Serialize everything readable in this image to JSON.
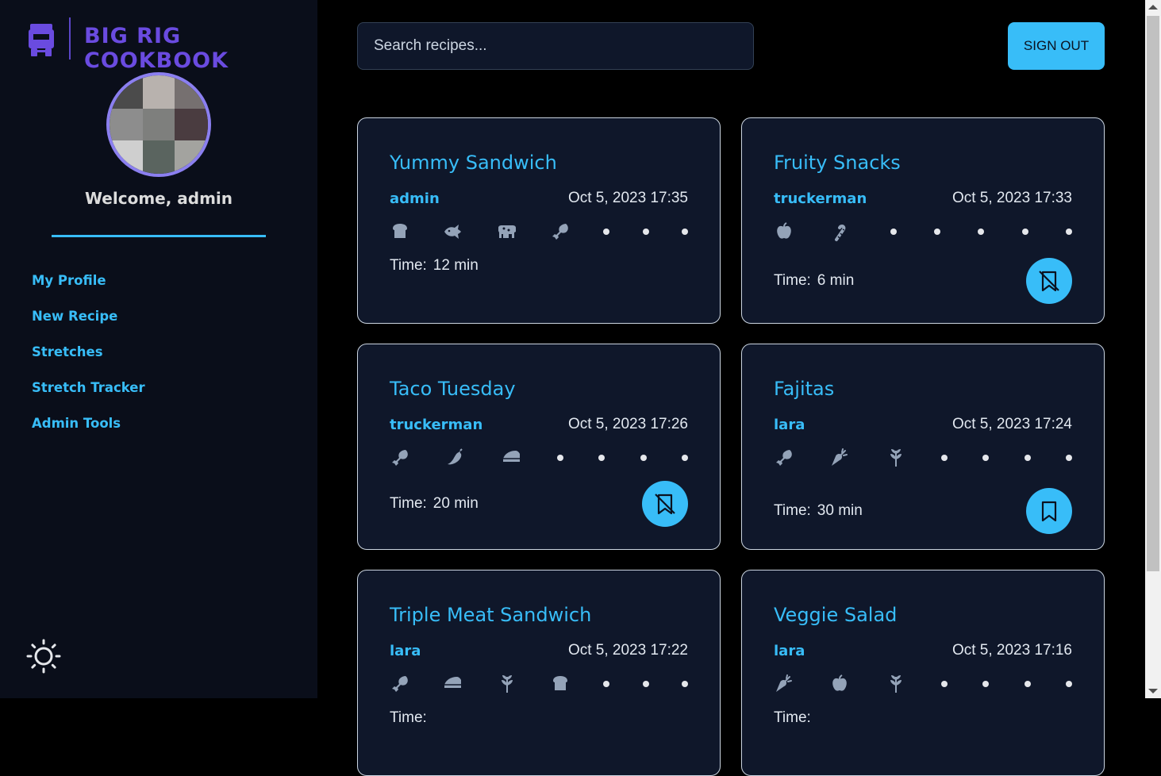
{
  "app": {
    "title": "BIG RIG COOKBOOK",
    "welcome": "Welcome, admin"
  },
  "sidebar": {
    "items": [
      {
        "label": "My Profile"
      },
      {
        "label": "New Recipe"
      },
      {
        "label": "Stretches"
      },
      {
        "label": "Stretch Tracker"
      },
      {
        "label": "Admin Tools"
      }
    ]
  },
  "header": {
    "search_placeholder": "Search recipes...",
    "signout_label": "SIGN OUT"
  },
  "recipes": [
    {
      "title": "Yummy Sandwich",
      "author": "admin",
      "date": "Oct 5, 2023 17:35",
      "time_label": "Time:",
      "time": "12 min",
      "icons": [
        "bread-icon",
        "fish-icon",
        "cow-icon",
        "drumstick-icon"
      ],
      "dots": 3,
      "favorite": "none"
    },
    {
      "title": "Fruity Snacks",
      "author": "truckerman",
      "date": "Oct 5, 2023 17:33",
      "time_label": "Time:",
      "time": "6 min",
      "icons": [
        "apple-icon",
        "candy-cane-icon"
      ],
      "dots": 5,
      "favorite": "bookmark-slash-icon"
    },
    {
      "title": "Taco Tuesday",
      "author": "truckerman",
      "date": "Oct 5, 2023 17:26",
      "time_label": "Time:",
      "time": "20 min",
      "icons": [
        "drumstick-icon",
        "pepper-icon",
        "cheese-icon"
      ],
      "dots": 4,
      "favorite": "bookmark-slash-icon"
    },
    {
      "title": "Fajitas",
      "author": "lara",
      "date": "Oct 5, 2023 17:24",
      "time_label": "Time:",
      "time": "30 min",
      "icons": [
        "drumstick-icon",
        "carrot-icon",
        "leaf-icon"
      ],
      "dots": 4,
      "favorite": "bookmark-icon"
    },
    {
      "title": "Triple Meat Sandwich",
      "author": "lara",
      "date": "Oct 5, 2023 17:22",
      "time_label": "Time:",
      "time": "",
      "icons": [
        "drumstick-icon",
        "cheese-icon",
        "leaf-icon",
        "bread-icon"
      ],
      "dots": 3,
      "favorite": "none"
    },
    {
      "title": "Veggie Salad",
      "author": "lara",
      "date": "Oct 5, 2023 17:16",
      "time_label": "Time:",
      "time": "",
      "icons": [
        "carrot-icon",
        "apple-icon",
        "leaf-icon"
      ],
      "dots": 4,
      "favorite": "none"
    }
  ],
  "colors": {
    "accent": "#38bdf8",
    "brand": "#6a4be0",
    "card_bg": "#0f172a",
    "icon": "#94a3b8"
  }
}
